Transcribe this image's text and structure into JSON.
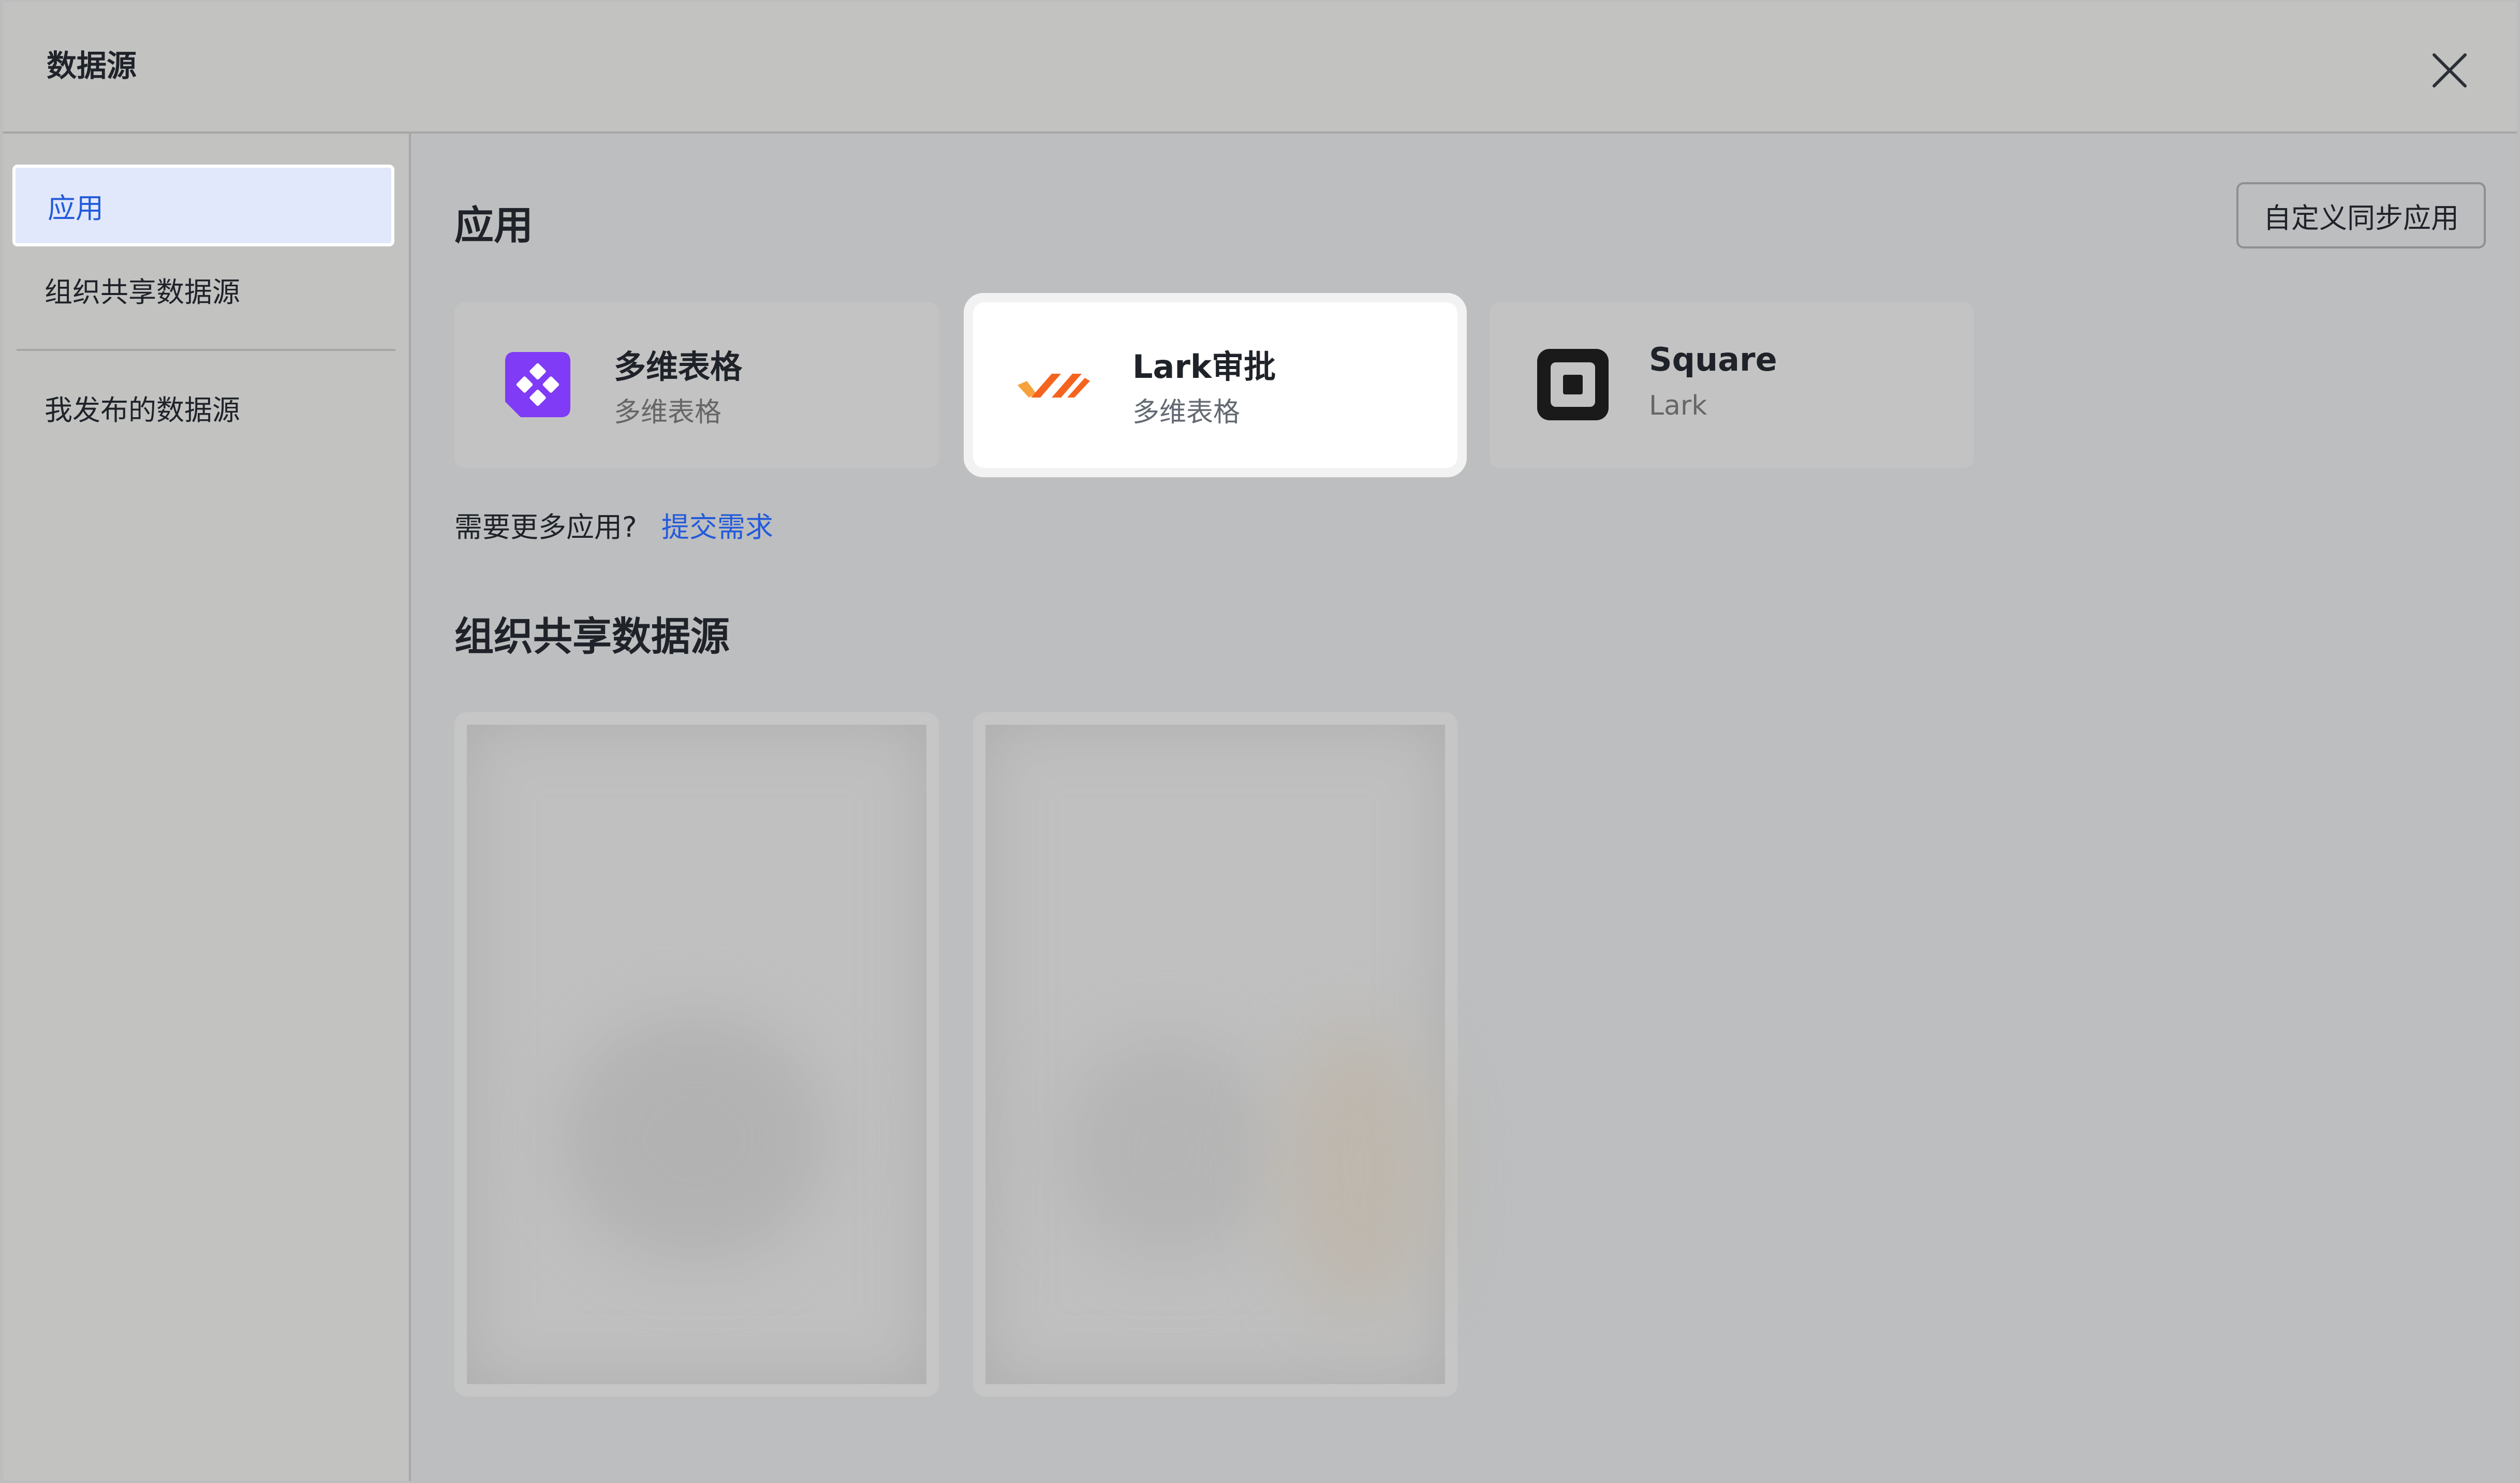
{
  "header": {
    "title": "数据源"
  },
  "sidebar": {
    "items": [
      {
        "label": "应用",
        "active": true
      },
      {
        "label": "组织共享数据源",
        "active": false
      },
      {
        "label": "我发布的数据源",
        "active": false
      }
    ]
  },
  "main": {
    "apps_section_title": "应用",
    "custom_sync_button": "自定义同步应用",
    "apps": [
      {
        "name": "多维表格",
        "subtitle": "多维表格",
        "icon": "bitable-icon"
      },
      {
        "name": "Lark审批",
        "subtitle": "多维表格",
        "icon": "approval-icon"
      },
      {
        "name": "Square",
        "subtitle": "Lark",
        "icon": "square-icon"
      }
    ],
    "more_apps_prompt": "需要更多应用?",
    "submit_request_link": "提交需求",
    "shared_section_title": "组织共享数据源"
  },
  "colors": {
    "accent": "#245bdb",
    "bitable_purple": "#7f3bf5",
    "approval_orange": "#f5641e",
    "square_black": "#1a1a1a"
  }
}
